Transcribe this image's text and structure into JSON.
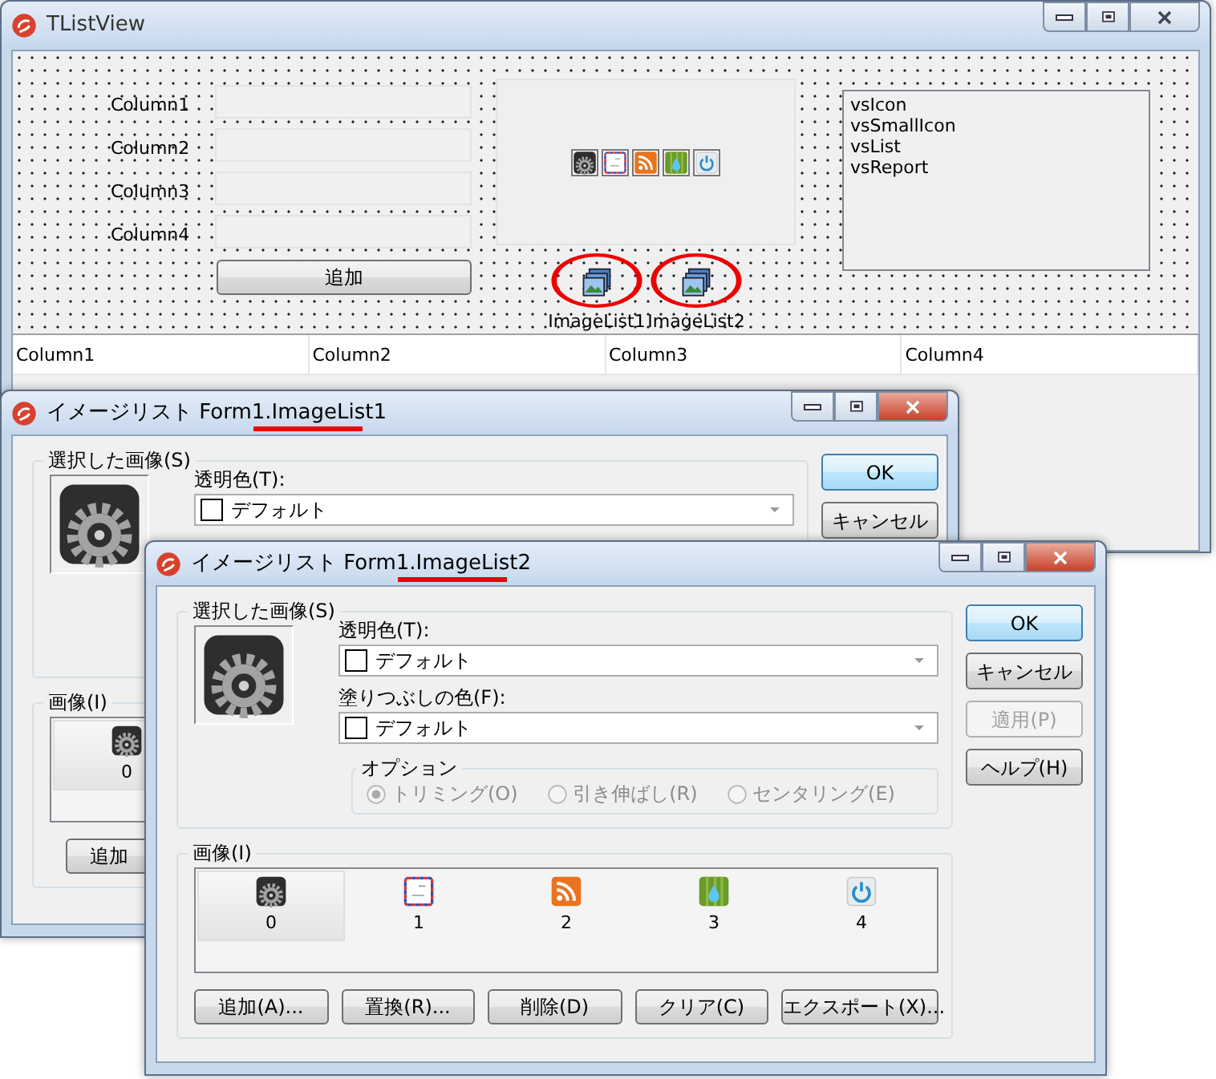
{
  "main_window": {
    "title": "TListView",
    "active": false,
    "field_labels": [
      "Column1",
      "Column2",
      "Column3",
      "Column4"
    ],
    "add_button": "追加",
    "panel_images": [
      {
        "kind": "gear"
      },
      {
        "kind": "mail"
      },
      {
        "kind": "rss"
      },
      {
        "kind": "water"
      },
      {
        "kind": "power"
      }
    ],
    "view_styles": [
      "vsIcon",
      "vsSmallIcon",
      "vsList",
      "vsReport"
    ],
    "components": [
      {
        "label": "ImageList1",
        "circled": true
      },
      {
        "label": "ImageList2",
        "circled": true
      }
    ],
    "list_columns": [
      "Column1",
      "Column2",
      "Column3",
      "Column4"
    ]
  },
  "dialogs": [
    {
      "title": "イメージリスト Form1.ImageList1",
      "underlined": true,
      "active": true,
      "selected_image_label": "選択した画像(S)",
      "preview": {
        "kind": "gear"
      },
      "fields": [
        {
          "label": "透明色(T):",
          "value": "デフォルト"
        }
      ],
      "buttons": [
        {
          "label": "OK",
          "default": true,
          "disabled": false
        },
        {
          "label": "キャンセル",
          "default": false,
          "disabled": false
        }
      ],
      "images_label": "画像(I)",
      "images": [
        {
          "kind": "gear",
          "label": "0",
          "selected": true
        }
      ],
      "bottom_buttons": [
        "追加"
      ]
    },
    {
      "title": "イメージリスト Form1.ImageList2",
      "underlined": true,
      "active": true,
      "selected_image_label": "選択した画像(S)",
      "preview": {
        "kind": "gear"
      },
      "fields": [
        {
          "label": "透明色(T):",
          "value": "デフォルト"
        },
        {
          "label": "塗りつぶしの色(F):",
          "value": "デフォルト"
        }
      ],
      "options_label": "オプション",
      "options": [
        {
          "label": "トリミング(O)",
          "selected": true,
          "disabled": true
        },
        {
          "label": "引き伸ばし(R)",
          "selected": false,
          "disabled": true
        },
        {
          "label": "センタリング(E)",
          "selected": false,
          "disabled": true
        }
      ],
      "buttons": [
        {
          "label": "OK",
          "default": true,
          "disabled": false
        },
        {
          "label": "キャンセル",
          "default": false,
          "disabled": false
        },
        {
          "label": "適用(P)",
          "default": false,
          "disabled": true
        },
        {
          "label": "ヘルプ(H)",
          "default": false,
          "disabled": false
        }
      ],
      "images_label": "画像(I)",
      "images": [
        {
          "kind": "gear",
          "label": "0",
          "selected": true
        },
        {
          "kind": "mail",
          "label": "1",
          "selected": false
        },
        {
          "kind": "rss",
          "label": "2",
          "selected": false
        },
        {
          "kind": "water",
          "label": "3",
          "selected": false
        },
        {
          "kind": "power",
          "label": "4",
          "selected": false
        }
      ],
      "bottom_buttons": [
        "追加(A)...",
        "置換(R)...",
        "削除(D)",
        "クリア(C)",
        "エクスポート(X)..."
      ]
    }
  ]
}
